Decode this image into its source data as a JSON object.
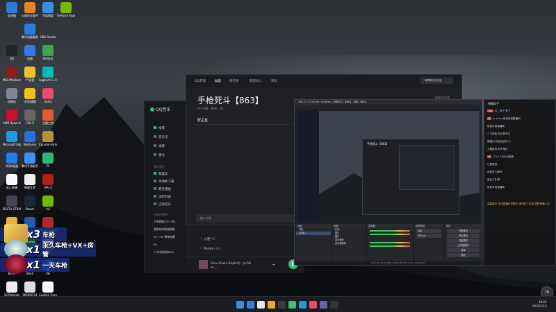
{
  "desktop": {
    "icons": [
      {
        "label": "此电脑",
        "color": "#2e78d6"
      },
      {
        "label": "火绒安全软件",
        "color": "#e8832a"
      },
      {
        "label": "百度网盘",
        "color": "#3a8ee6"
      },
      {
        "label": "GeForce Experience",
        "color": "#76b900"
      },
      {
        "label": "腾讯电脑管家",
        "color": "#2a7de1"
      },
      {
        "label": "OBS Studio",
        "color": "#333438"
      },
      {
        "label": "QQ",
        "color": "#222"
      },
      {
        "label": "迅雷",
        "color": "#2f7bf0"
      },
      {
        "label": "360安全",
        "color": "#3aa655"
      },
      {
        "label": "MSI Afterburner",
        "color": "#8a1d1d"
      },
      {
        "label": "YY语音",
        "color": "#f2c12e"
      },
      {
        "label": "Logitech G HUB",
        "color": "#0bb"
      },
      {
        "label": "回收站",
        "color": "#7d8794"
      },
      {
        "label": "UU加速器",
        "color": "#f0c020"
      },
      {
        "label": "Uplay",
        "color": "#e84a6a"
      },
      {
        "label": "AMD Ryzen Master",
        "color": "#c8102e"
      },
      {
        "label": "CPU-Z",
        "color": "#666"
      },
      {
        "label": "主题工具",
        "color": "#e05a2a"
      },
      {
        "label": "Microsoft Edge",
        "color": "#1f9be0"
      },
      {
        "label": "WeGame",
        "color": "#2a6fdc"
      },
      {
        "label": "Counter-Strike",
        "color": "#b8903a"
      },
      {
        "label": "QQ浏览器",
        "color": "#1e7be8"
      },
      {
        "label": "腾讯手游助手",
        "color": "#3d8ff0"
      },
      {
        "label": "Tii",
        "color": "#2bb673"
      },
      {
        "label": "doc.新建",
        "color": "#fafafa"
      },
      {
        "label": "新建文本",
        "color": "#eeeeee"
      },
      {
        "label": "GPU-Z",
        "color": "#b02020"
      },
      {
        "label": "DEATH STRANDING",
        "color": "#445"
      },
      {
        "label": "Steam",
        "color": "#1b2838"
      },
      {
        "label": "nvi",
        "color": "#76b900"
      },
      {
        "label": "文件管理",
        "color": "#e8b23a"
      },
      {
        "label": "AIDA64 Extreme",
        "color": "#1e5fa8"
      },
      {
        "label": "CPUID CPU-Z MSI",
        "color": "#b02a2a"
      },
      {
        "label": "EPIC",
        "color": "#111"
      },
      {
        "label": "微信",
        "color": "#2dc100"
      },
      {
        "label": "Lunar",
        "color": "#aaa"
      },
      {
        "label": "Excel",
        "color": "#1d7044"
      },
      {
        "label": "Word",
        "color": "#2b579a"
      },
      {
        "label": "Ubi",
        "color": "#2a5ad1"
      },
      {
        "label": "12.Refunds",
        "color": "#eeeeee"
      },
      {
        "label": "1K4000·01",
        "color": "#dddddd"
      },
      {
        "label": "Custom Cursor",
        "color": "#ffffff"
      }
    ]
  },
  "overlay": {
    "banners": [
      {
        "mult": "x3",
        "text": "车枪"
      },
      {
        "mult": "x1",
        "text": "永久车枪+VX+房管"
      },
      {
        "mult": "x1",
        "text": "一天车枪"
      }
    ]
  },
  "qq_music": {
    "logo": "QQ音乐",
    "nav_group1": [
      "推荐",
      "音乐馆",
      "视频",
      "雷达"
    ],
    "nav_head2": "我的音乐",
    "nav_group2": [
      "我喜欢",
      "本地和下载",
      "最近播放",
      "试听列表",
      "已购音乐"
    ],
    "nav_head3": "创建的歌单",
    "playlists": [
      "下载歌曲(2021年)",
      "我喜欢的歌曲收藏",
      "SO YOU 歌单收藏",
      "95",
      "21年的游戏BGM"
    ],
    "rows": [
      {
        "name": "入迷",
        "tag": "SQ"
      },
      {
        "name": "Pardon",
        "tag": "SQ"
      }
    ],
    "player": {
      "song": "Zhou Shahli (Explicit) · Jie Mo",
      "time": "02:14"
    }
  },
  "chat_window": {
    "tabs": [
      "QQ游戏",
      "动态",
      "排行榜",
      "频道加入",
      "我的"
    ],
    "active_tab": "动态",
    "pill": "单群聊天已开启",
    "title": "手枪死斗【863】",
    "subtitle": "Hi-Hi群 · 聊天 · 群",
    "owner": "群主室",
    "history": "查看历史记录",
    "input_placeholder": "输入内容"
  },
  "obs": {
    "title": "OBS 27.1.3 (64-bit, windows) - 配置文件: 未命名 - 场景: 未命名",
    "preview_title": "手枪死斗【863】",
    "docks": [
      {
        "label": "场景"
      },
      {
        "label": "来源"
      },
      {
        "label": "混音器"
      },
      {
        "label": "转场特效"
      },
      {
        "label": "控件"
      }
    ],
    "scenes": [
      "场景",
      "QQ屏"
    ],
    "sources": [
      "拉流",
      "图片",
      "图片",
      "游戏捕获",
      "显示器捕获"
    ],
    "transition": {
      "type": "淡出",
      "duration": "300 ms"
    },
    "controls": [
      "开始推流",
      "停止推流",
      "开始录制",
      "工作室模式",
      "设置",
      "退出"
    ],
    "status": "LIVE: 02:14:05   REC: 00:00:00   CPU: 9.2%, 60.00 fps"
  },
  "danmaku": {
    "title": "弹幕助手",
    "messages": [
      {
        "lv": "22",
        "name": "刘二麻子",
        "text": "来了"
      },
      {
        "lv": "6",
        "name": "Jingling",
        "text": "欢迎来到直播间"
      },
      {
        "lv": "",
        "name": "",
        "text": "欢迎来到直播间"
      },
      {
        "lv": "",
        "name": "",
        "text": "一下就能,先点赞关注"
      },
      {
        "lv": "",
        "name": "",
        "text": "感谢[小兵]送出的1个"
      },
      {
        "lv": "",
        "name": "",
        "text": "主播真的,玩不明白"
      },
      {
        "lv": "3",
        "name": "FF20",
        "text": "7000元能换"
      },
      {
        "lv": "",
        "name": "",
        "text": "已被禁言"
      },
      {
        "lv": "",
        "name": "",
        "text": "欢迎进入房间"
      },
      {
        "lv": "",
        "name": "",
        "text": "送出了礼物"
      },
      {
        "lv": "",
        "name": "",
        "text": "欢迎来到直播间"
      }
    ],
    "notice": "温馨提示:本场直播仅供娱乐,请勿私下交易,谨防受骗上当"
  },
  "taskbar": {
    "time": "18:22",
    "date": "2022/1/13",
    "icons": [
      "#3a8ee6",
      "#2d7ff9",
      "#e6e6e6",
      "#f2a33a",
      "#3b3b3b",
      "#31c27c",
      "#1f9be0",
      "#e84a6a",
      "#6264a7",
      "#333438"
    ]
  },
  "avatar": {
    "text": "78"
  }
}
